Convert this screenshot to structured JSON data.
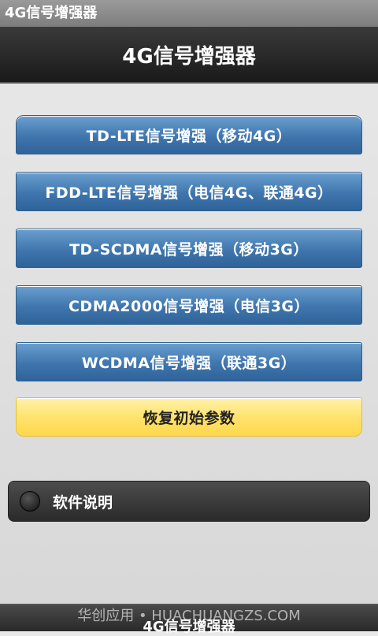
{
  "statusbar": {
    "app_name": "4G信号增强器"
  },
  "header": {
    "title": "4G信号增强器"
  },
  "buttons": [
    {
      "label": "TD-LTE信号增强（移动4G）"
    },
    {
      "label": "FDD-LTE信号增强（电信4G、联通4G）"
    },
    {
      "label": "TD-SCDMA信号增强（移动3G）"
    },
    {
      "label": "CDMA2000信号增强（电信3G）"
    },
    {
      "label": "WCDMA信号增强（联通3G）"
    }
  ],
  "reset": {
    "label": "恢复初始参数"
  },
  "help_toggle": {
    "label": "软件说明",
    "checked": false
  },
  "footer": {
    "title": "4G信号增强器",
    "watermark": "华创应用 • HUACHUANGZS.COM"
  },
  "colors": {
    "button_blue": "#3f76ad",
    "reset_yellow": "#ffe16a",
    "toggle_dark": "#2a2a2a"
  }
}
